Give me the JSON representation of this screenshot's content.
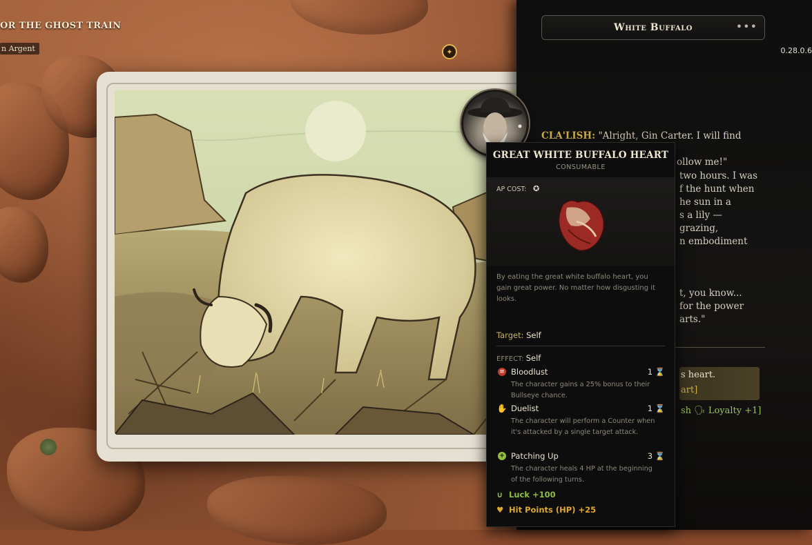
{
  "map": {
    "quest_title": "OR THE GHOST TRAIN",
    "quest_subtitle": "n Argent"
  },
  "panel": {
    "title": "White Buffalo",
    "more_label": "•••",
    "version": "0.28.0.6",
    "speaker": "CLA'LISH:",
    "line1_a": "\"Alright, Gin Carter. I will find that",
    "line1_b": "ollow me!\"",
    "p2": [
      "two hours. I was",
      "f the hunt when",
      "he sun in a",
      "s a lily — grazing,",
      "n embodiment"
    ],
    "p3": [
      "t, you know...",
      "for the power",
      "arts.\""
    ],
    "option1": "s heart.",
    "option2": "art]",
    "option3": "sh 🗣 Loyalty +1]"
  },
  "tooltip": {
    "title": "Great White Buffalo Heart",
    "type": "CONSUMABLE",
    "ap_cost_label": "AP COST:",
    "description": "By eating the great white buffalo heart, you gain great power. No matter how disgusting it looks.",
    "target_label": "Target:",
    "target_value": "Self",
    "effect_label": "EFFECT:",
    "effect_value": "Self",
    "effects": [
      {
        "name": "Bloodlust",
        "turns": "1 ⌛",
        "desc": "The character gains a 25% bonus to their Bullseye chance.",
        "icon": "bloodlust-icon",
        "color": "#c0392b"
      },
      {
        "name": "Duelist",
        "turns": "1 ⌛",
        "desc": "The character will perform a Counter when it's attacked by a single target attack.",
        "icon": "duelist-icon",
        "color": "#e8e1d2"
      },
      {
        "name": "Patching Up",
        "turns": "3 ⌛",
        "desc": "The character heals 4 HP at the beginning of the following turns.",
        "icon": "patching-up-icon",
        "color": "#8fbf3f"
      }
    ],
    "stats": [
      {
        "label": "Luck +100",
        "icon": "horseshoe-icon",
        "color": "#8fbf3f"
      },
      {
        "label": "Hit Points (HP) +25",
        "icon": "heart-hp-icon",
        "color": "#e0a92b"
      }
    ]
  }
}
